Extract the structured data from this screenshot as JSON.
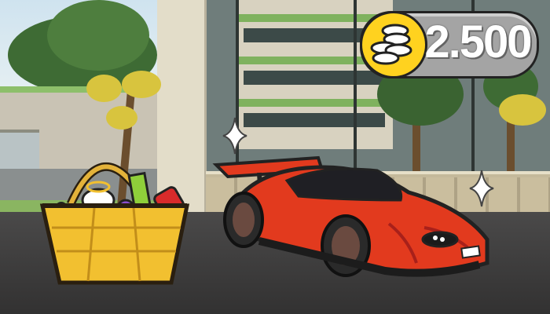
{
  "hud": {
    "coin_count": "2.500",
    "coin_icon": "coin-stack-icon"
  },
  "colors": {
    "coin_gold": "#ffd21f",
    "pill_gray": "#a4a4a4",
    "car_red": "#e23a1e",
    "basket_yellow": "#f2c030"
  },
  "scene": {
    "items": [
      "gift-basket",
      "red-sports-car",
      "sparkle-icon"
    ]
  }
}
